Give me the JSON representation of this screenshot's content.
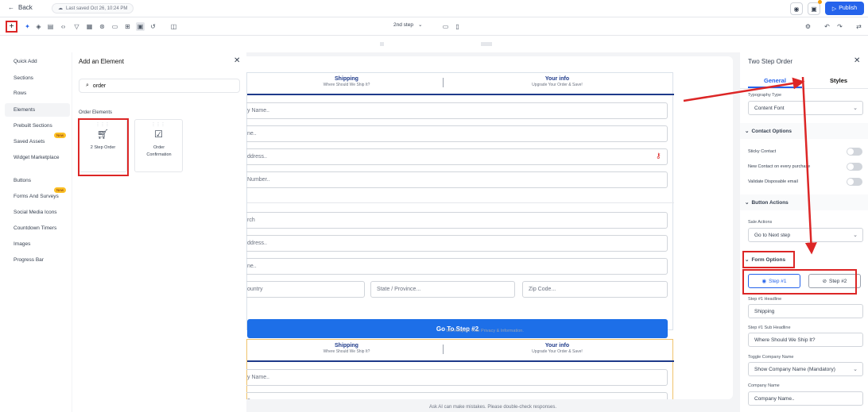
{
  "topbar": {
    "back_label": "Back",
    "saved_text": "Last saved Oct 26, 10:24 PM",
    "publish_label": "Publish"
  },
  "toolbar": {
    "step_select": "2nd step",
    "icons": [
      "plus-icon",
      "sparkle-icon",
      "layers-icon",
      "page-icon",
      "code-icon",
      "funnel-icon",
      "grid-icon",
      "ai-icon",
      "layout-icon",
      "table-icon",
      "image-icon",
      "undo-icon",
      "panel-icon"
    ]
  },
  "left_nav": {
    "items": [
      "Quick Add",
      "Sections",
      "Rows",
      "Elements",
      "Prebuilt Sections",
      "Saved Assets",
      "Widget Marketplace",
      "Buttons",
      "Forms And Surveys",
      "Social Media Icons",
      "Countdown Timers",
      "Images",
      "Progress Bar"
    ],
    "new_badge": "New"
  },
  "element_panel": {
    "title": "Add an Element",
    "search_value": "order",
    "group_label": "Order Elements",
    "cards": [
      {
        "label": "2 Step Order",
        "icon": "cart-icon"
      },
      {
        "label": "Order Confirmation",
        "icon": "checkbox-icon"
      }
    ]
  },
  "canvas": {
    "steps": [
      {
        "headline": "Shipping",
        "sub": "Where Should We Ship It?"
      },
      {
        "headline": "Your info",
        "sub": "Upgrade Your Order & Save!"
      }
    ],
    "fields": [
      "y Name..",
      "ne..",
      "ddress..",
      "Number..",
      "rch",
      "ddress..",
      "ne..",
      "ountry",
      "State / Province...",
      "Zip Code..."
    ],
    "second_fields": [
      "y Name..",
      "e"
    ],
    "goto_label": "Go To Step #2",
    "privacy_text": "We Respect Your Privacy & Information.",
    "ai_note": "Ask AI can make mistakes. Please double-check responses."
  },
  "right_panel": {
    "title": "Two Step Order",
    "tab_general": "General",
    "tab_styles": "Styles",
    "typography_label": "Typography Type",
    "typography_value": "Content Font",
    "contact_options": "Contact Options",
    "toggles": [
      "Sticky Contact",
      "New Contact on every purchase",
      "Validate Disposable email"
    ],
    "button_actions": "Button Actions",
    "sale_actions_label": "Sale Actions",
    "sale_actions_value": "Go to Next step",
    "form_options": "Form Options",
    "step1_btn": "Step #1",
    "step2_btn": "Step #2",
    "step1_headline_label": "Step #1 Headline",
    "step1_headline_value": "Shipping",
    "step1_sub_label": "Step #1 Sub Headline",
    "step1_sub_value": "Where Should We Ship It?",
    "toggle_company_label": "Toggle Company Name",
    "toggle_company_value": "Show Company Name (Mandatory)",
    "company_name_label": "Company Name",
    "company_name_value": "Company Name.."
  },
  "colors": {
    "accent": "#2563eb",
    "highlight": "#dc2626",
    "button": "#1d6fe8"
  }
}
